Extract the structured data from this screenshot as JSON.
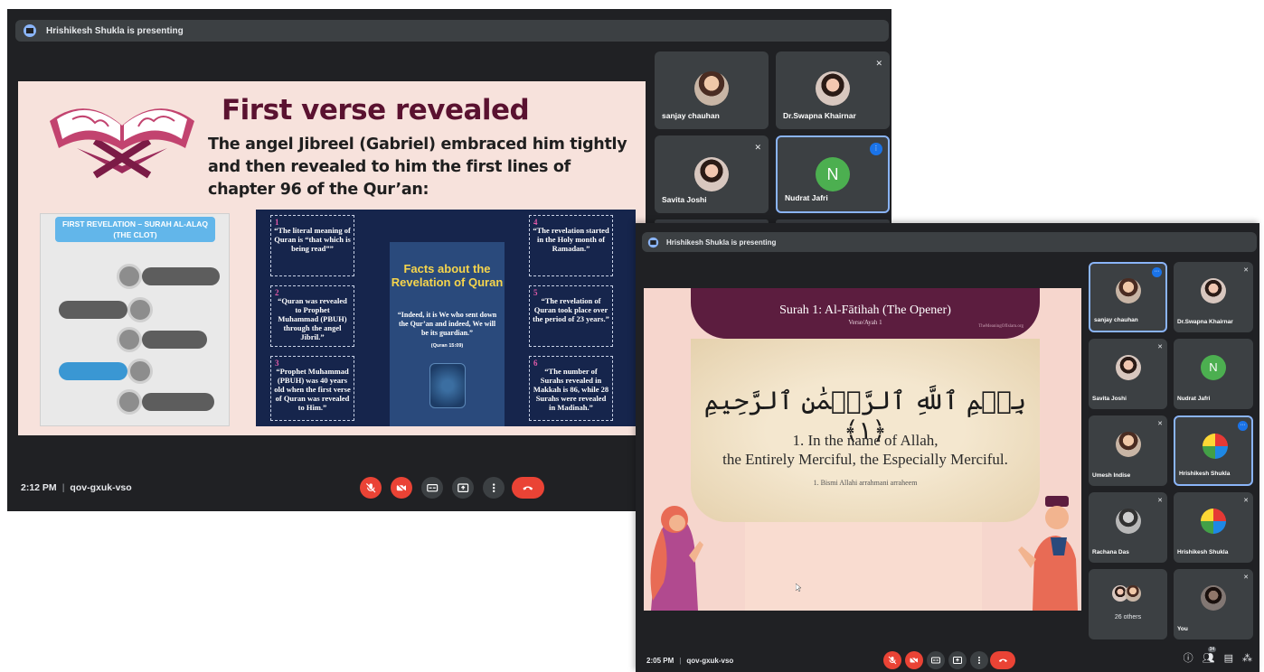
{
  "window1": {
    "presenting": "Hrishikesh Shukla is presenting",
    "time": "2:12 PM",
    "meeting_code": "qov-gxuk-vso",
    "slide": {
      "title": "First verse revealed",
      "subtitle": "The angel Jibreel (Gabriel) embraced him tightly and then revealed to him the first lines of chapter 96 of the Qur’an:",
      "clot_header_line1": "FIRST REVELATION – SURAH AL-ALAQ",
      "clot_header_line2": "(THE CLOT)",
      "facts_title": "Facts about the Revelation of Quran",
      "facts_quote": "“Indeed, it is We who sent down the Qur’an and indeed, We will be its guardian.”",
      "facts_ref": "(Quran 15:09)",
      "facts": [
        {
          "num": "1",
          "text": "“The literal meaning of Quran is “that which is being read””"
        },
        {
          "num": "2",
          "text": "“Quran was revealed to Prophet Muhammad (PBUH) through the angel Jibril.”"
        },
        {
          "num": "3",
          "text": "“Prophet Muhammad (PBUH) was 40 years old when the first verse of Quran was revealed to Him.”"
        },
        {
          "num": "4",
          "text": "“The revelation started in the Holy month of Ramadan.”"
        },
        {
          "num": "5",
          "text": "“The revelation of Quran took place over the period of 23 years.”"
        },
        {
          "num": "6",
          "text": "“The number of Surahs revealed in Makkah is 86, while 28 Surahs were revealed in Madinah.”"
        }
      ]
    },
    "participants": [
      {
        "name": "sanjay chauhan"
      },
      {
        "name": "Dr.Swapna Khairnar"
      },
      {
        "name": "Savita Joshi"
      },
      {
        "name": "Nudrat Jafri",
        "initial": "N"
      }
    ]
  },
  "window2": {
    "presenting": "Hrishikesh Shukla is presenting",
    "time": "2:05 PM",
    "meeting_code": "qov-gxuk-vso",
    "slide": {
      "title": "Surah 1: Al-Fātihah (The Opener)",
      "verse": "Verse/Ayah 1",
      "watermark": "TheMeaningOfIslam.org",
      "arabic": "بِسۡمِ ٱللَّهِ ٱلرَّحۡمَٰنِ ٱلرَّحِيمِ ﴿١﴾",
      "translation_line1": "1. In the name of Allah,",
      "translation_line2": "the Entirely Merciful, the Especially Merciful.",
      "transliteration": "1. Bismi Allahi arrahmani arraheem"
    },
    "participants": [
      {
        "name": "sanjay chauhan"
      },
      {
        "name": "Dr.Swapna Khairnar"
      },
      {
        "name": "Savita Joshi"
      },
      {
        "name": "Nudrat Jafri",
        "initial": "N"
      },
      {
        "name": "Umesh Indise"
      },
      {
        "name": "Hrishikesh Shukla"
      },
      {
        "name": "Rachana Das"
      },
      {
        "name": "Hrishikesh Shukla"
      },
      {
        "name": "26 others"
      },
      {
        "name": "You"
      }
    ],
    "people_count": "34"
  },
  "colors": {
    "meet_bg": "#202124",
    "tile_bg": "#3c4043",
    "end_call": "#ea4335",
    "active_border": "#8ab4f8",
    "slide1_title": "#5a1230",
    "slide2_band": "#5c1d3f"
  }
}
